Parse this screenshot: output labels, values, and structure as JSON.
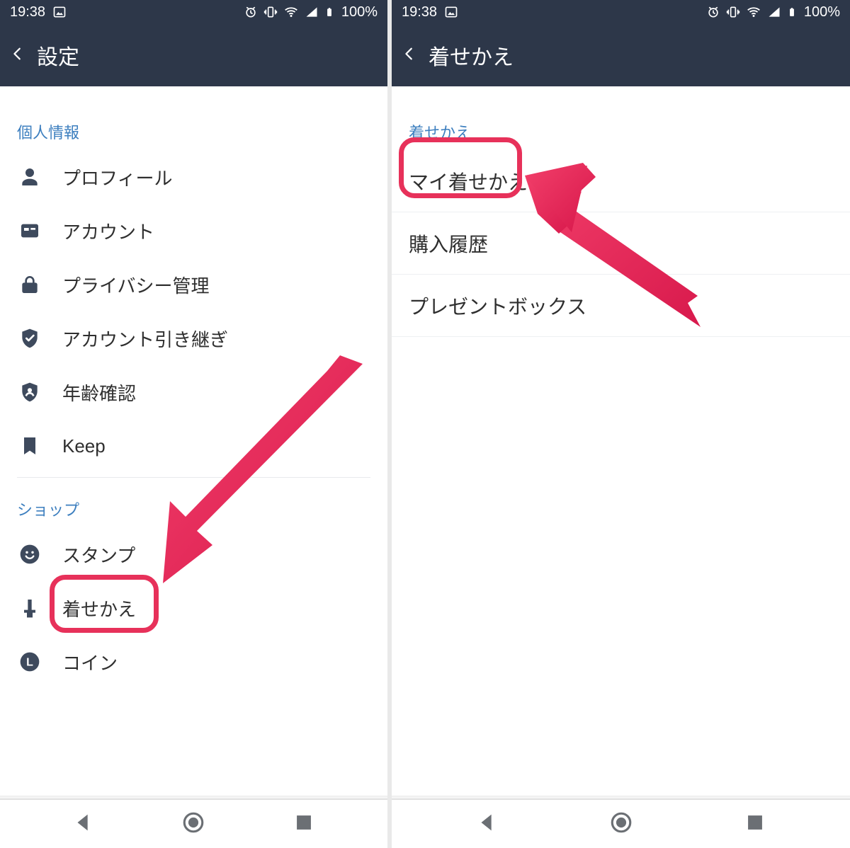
{
  "status_bar": {
    "time": "19:38",
    "battery": "100%"
  },
  "left": {
    "title": "設定",
    "section_personal": "個人情報",
    "items_personal": {
      "profile": "プロフィール",
      "account": "アカウント",
      "privacy": "プライバシー管理",
      "takeover": "アカウント引き継ぎ",
      "age": "年齢確認",
      "keep": "Keep"
    },
    "section_shop": "ショップ",
    "items_shop": {
      "stamp": "スタンプ",
      "theme": "着せかえ",
      "coin": "コイン"
    }
  },
  "right": {
    "title": "着せかえ",
    "section_theme": "着せかえ",
    "items": {
      "my_theme": "マイ着せかえ",
      "history": "購入履歴",
      "present": "プレゼントボックス"
    }
  }
}
